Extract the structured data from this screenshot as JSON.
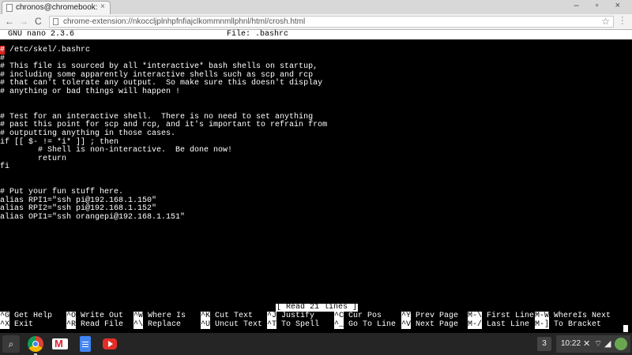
{
  "browser": {
    "tab_title": "chronos@chromebook:~",
    "tab_close": "×",
    "window_controls": "– ▫ ×",
    "nav_back": "←",
    "nav_forward": "→",
    "nav_reload": "C",
    "url": "chrome-extension://nkoccljplnhpfnfiajclkommnmllphnl/html/crosh.html"
  },
  "nano": {
    "version": "GNU nano 2.3.6",
    "file_label": "File: .bashrc",
    "status_message": "[ Read 21 lines ]"
  },
  "file_lines": [
    "# /etc/skel/.bashrc",
    "#",
    "# This file is sourced by all *interactive* bash shells on startup,",
    "# including some apparently interactive shells such as scp and rcp",
    "# that can't tolerate any output.  So make sure this doesn't display",
    "# anything or bad things will happen !",
    "",
    "",
    "# Test for an interactive shell.  There is no need to set anything",
    "# past this point for scp and rcp, and it's important to refrain from",
    "# outputting anything in those cases.",
    "if [[ $- != *i* ]] ; then",
    "        # Shell is non-interactive.  Be done now!",
    "        return",
    "fi",
    "",
    "",
    "# Put your fun stuff here.",
    "alias RPI1=\"ssh pi@192.168.1.150\"",
    "alias RPI2=\"ssh pi@192.168.1.152\"",
    "alias OPI1=\"ssh orangepi@192.168.1.151\""
  ],
  "shortcuts_row1": [
    {
      "key": "^G",
      "label": "Get Help"
    },
    {
      "key": "^O",
      "label": "Write Out"
    },
    {
      "key": "^W",
      "label": "Where Is"
    },
    {
      "key": "^K",
      "label": "Cut Text"
    },
    {
      "key": "^J",
      "label": "Justify"
    },
    {
      "key": "^C",
      "label": "Cur Pos"
    },
    {
      "key": "^Y",
      "label": "Prev Page"
    },
    {
      "key": "M-\\",
      "label": "First Line"
    },
    {
      "key": "M-W",
      "label": "WhereIs Next"
    }
  ],
  "shortcuts_row2": [
    {
      "key": "^X",
      "label": "Exit"
    },
    {
      "key": "^R",
      "label": "Read File"
    },
    {
      "key": "^\\",
      "label": "Replace"
    },
    {
      "key": "^U",
      "label": "Uncut Text"
    },
    {
      "key": "^T",
      "label": "To Spell"
    },
    {
      "key": "^_",
      "label": "Go To Line"
    },
    {
      "key": "^V",
      "label": "Next Page"
    },
    {
      "key": "M-/",
      "label": "Last Line"
    },
    {
      "key": "M-]",
      "label": "To Bracket"
    }
  ],
  "shelf": {
    "launcher_glyph": "⌕",
    "notification_count": "3",
    "time": "10:22",
    "apps": [
      "chrome-icon",
      "gmail-icon",
      "docs-icon",
      "youtube-icon"
    ]
  },
  "colors": {
    "terminal_bg": "#000000",
    "terminal_fg": "#ffffff",
    "highlight": "#dd2222"
  }
}
